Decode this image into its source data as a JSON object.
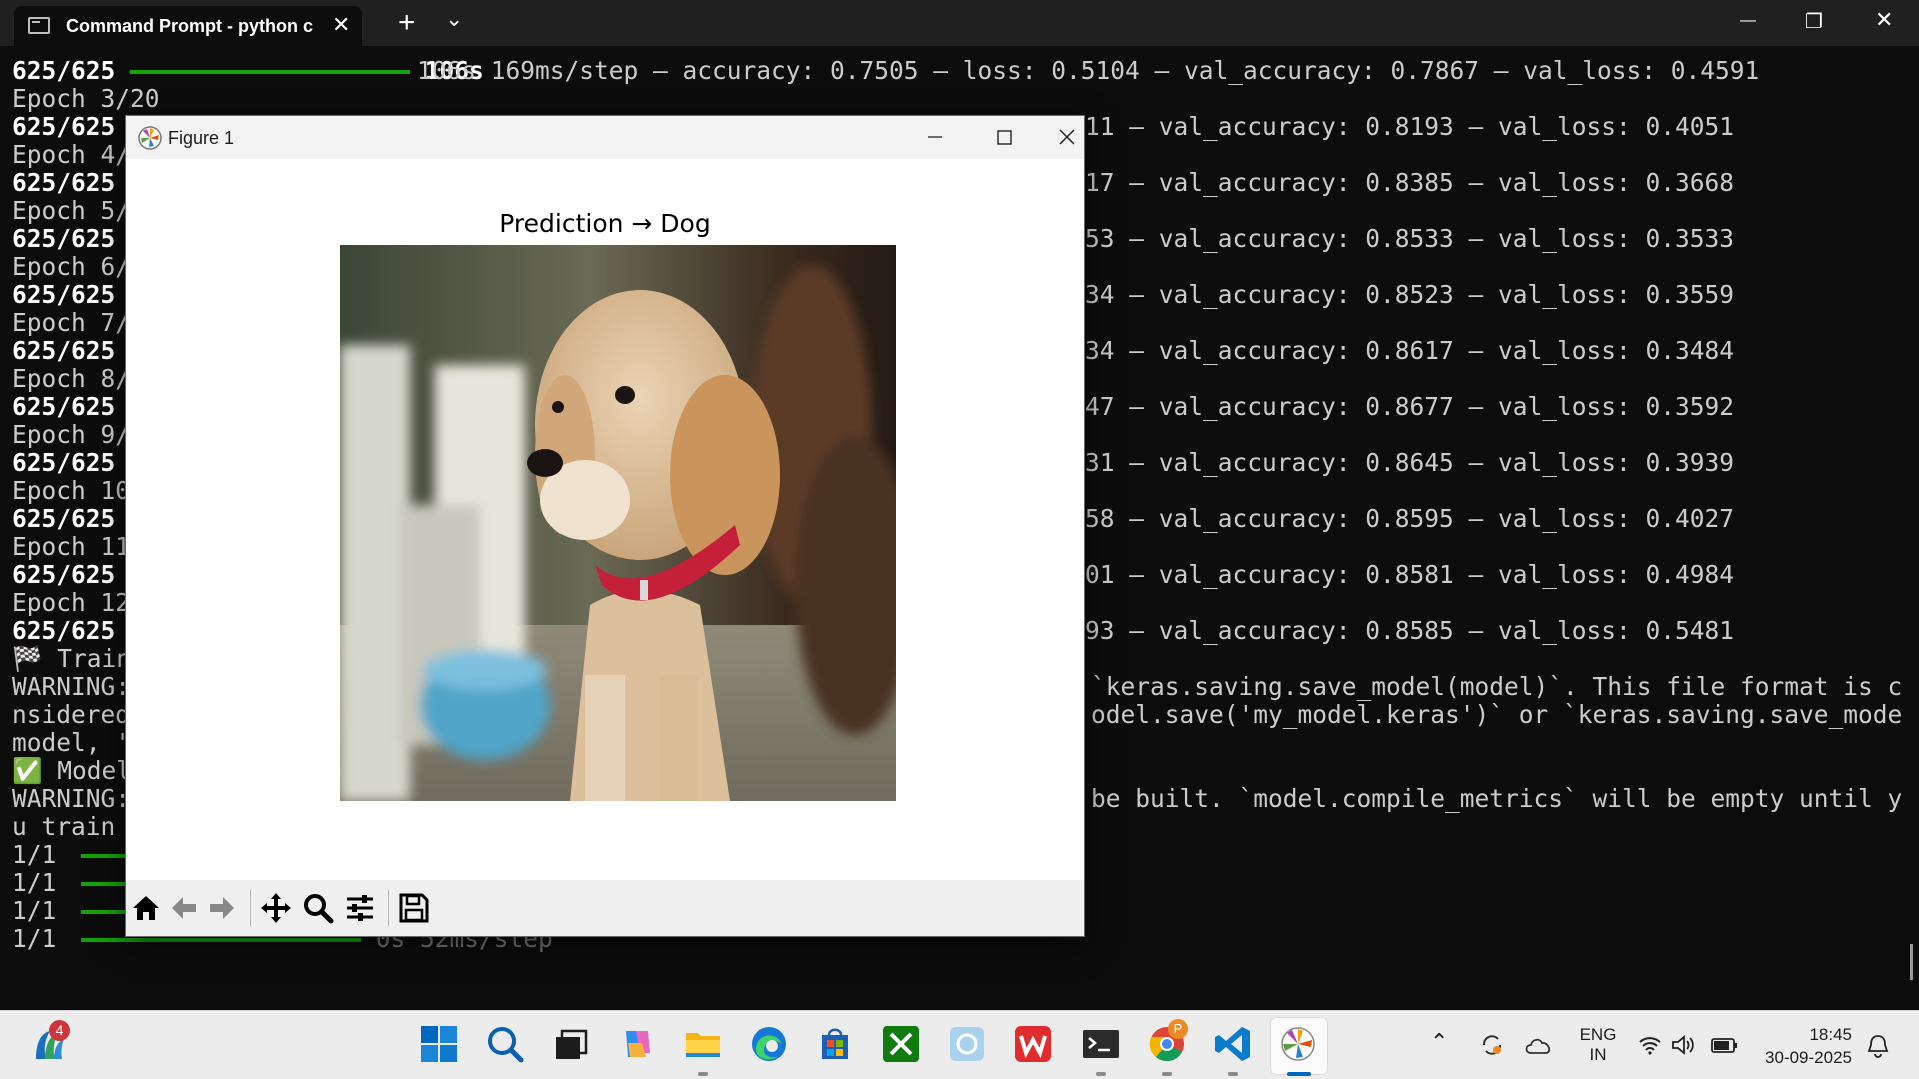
{
  "window": {
    "tab_title": "Command Prompt - python  c",
    "tab_close": "✕",
    "new_tab": "+",
    "dropdown": "⌄",
    "minimize": "—",
    "maximize": "❐",
    "close": "✕"
  },
  "terminal": {
    "lines": {
      "l0": {
        "prefix": "625/625",
        "text": "106s 169ms/step – accuracy: 0.7505 – loss: 0.5104 – val_accuracy: 0.7867 – val_loss: 0.4591"
      },
      "l1": "Epoch 3/20",
      "l2": {
        "prefix": "625/625",
        "text": "11 – val_accuracy: 0.8193 – val_loss: 0.4051"
      },
      "l3": "Epoch 4/",
      "l4": {
        "prefix": "625/625",
        "text": "17 – val_accuracy: 0.8385 – val_loss: 0.3668"
      },
      "l5": "Epoch 5/",
      "l6": {
        "prefix": "625/625",
        "text": "53 – val_accuracy: 0.8533 – val_loss: 0.3533"
      },
      "l7": "Epoch 6/",
      "l8": {
        "prefix": "625/625",
        "text": "34 – val_accuracy: 0.8523 – val_loss: 0.3559"
      },
      "l9": "Epoch 7/",
      "l10": {
        "prefix": "625/625",
        "text": "34 – val_accuracy: 0.8617 – val_loss: 0.3484"
      },
      "l11": "Epoch 8/",
      "l12": {
        "prefix": "625/625",
        "text": "47 – val_accuracy: 0.8677 – val_loss: 0.3592"
      },
      "l13": "Epoch 9/",
      "l14": {
        "prefix": "625/625",
        "text": "31 – val_accuracy: 0.8645 – val_loss: 0.3939"
      },
      "l15": "Epoch 10",
      "l16": {
        "prefix": "625/625",
        "text": "58 – val_accuracy: 0.8595 – val_loss: 0.4027"
      },
      "l17": "Epoch 11",
      "l18": {
        "prefix": "625/625",
        "text": "01 – val_accuracy: 0.8581 – val_loss: 0.4984"
      },
      "l19": "Epoch 12",
      "l20": {
        "prefix": "625/625",
        "text": "93 – val_accuracy: 0.8585 – val_loss: 0.5481"
      },
      "l21": {
        "left": "🏁 Train",
        "right": ""
      },
      "l22": {
        "left": "WARNING:",
        "right": "`keras.saving.save_model(model)`. This file format is co"
      },
      "l23": {
        "left": "nsidered",
        "right": "odel.save('my_model.keras')` or `keras.saving.save_model("
      },
      "l24": {
        "left": "model, '",
        "right": ""
      },
      "l25": {
        "left": "✅ Model",
        "right": ""
      },
      "l26": {
        "left": "WARNING:",
        "right": "be built. `model.compile_metrics` will be empty until yo"
      },
      "l27": "u train",
      "l28": "1/1",
      "l29": "1/1",
      "l30": "1/1",
      "l31": {
        "prefix": "1/1",
        "text": "0s 52ms/step"
      }
    }
  },
  "figure": {
    "window_title": "Figure 1",
    "plot_title": "Prediction → Dog",
    "toolbar": [
      "home-icon",
      "back-arrow-icon",
      "forward-arrow-icon",
      "pan-icon",
      "zoom-icon",
      "configure-subplots-icon",
      "save-icon"
    ]
  },
  "taskbar": {
    "widgets_badge": "4",
    "chrome_badge": "P",
    "lang_top": "ENG",
    "lang_bottom": "IN",
    "time": "18:45",
    "date": "30-09-2025",
    "apps": [
      "start",
      "search",
      "task-view",
      "copilot",
      "file-explorer",
      "edge",
      "store",
      "xbox",
      "app-placeholder",
      "wps-office",
      "terminal",
      "chrome",
      "vscode",
      "matplotlib-figure"
    ]
  },
  "colors": {
    "terminal_bg": "#0c0c0c",
    "progress_green": "#13a10e",
    "taskbar_bg": "#ececec",
    "accent": "#0067c0"
  }
}
